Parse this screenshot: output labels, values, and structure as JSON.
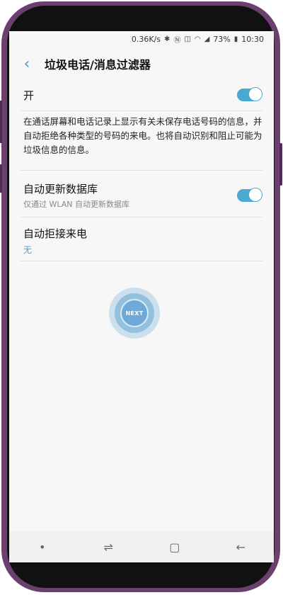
{
  "status_bar": {
    "speed": "0.36K/s",
    "battery": "73%",
    "time": "10:30"
  },
  "header": {
    "title": "垃圾电话/消息过滤器"
  },
  "main_toggle": {
    "label": "开",
    "on": true
  },
  "description": "在通话屏幕和电话记录上显示有关未保存电话号码的信息，并自动拒绝各种类型的号码的来电。也将自动识别和阻止可能为垃圾信息的信息。",
  "auto_update": {
    "label": "自动更新数据库",
    "sub": "仅通过 WLAN 自动更新数据库",
    "on": true
  },
  "auto_reject": {
    "label": "自动拒接来电",
    "value": "无"
  },
  "next_button": {
    "label": "NEXT"
  },
  "colors": {
    "accent": "#3aa4c8",
    "toggle_on": "#49a9cf",
    "frame": "#6b3f6e"
  }
}
